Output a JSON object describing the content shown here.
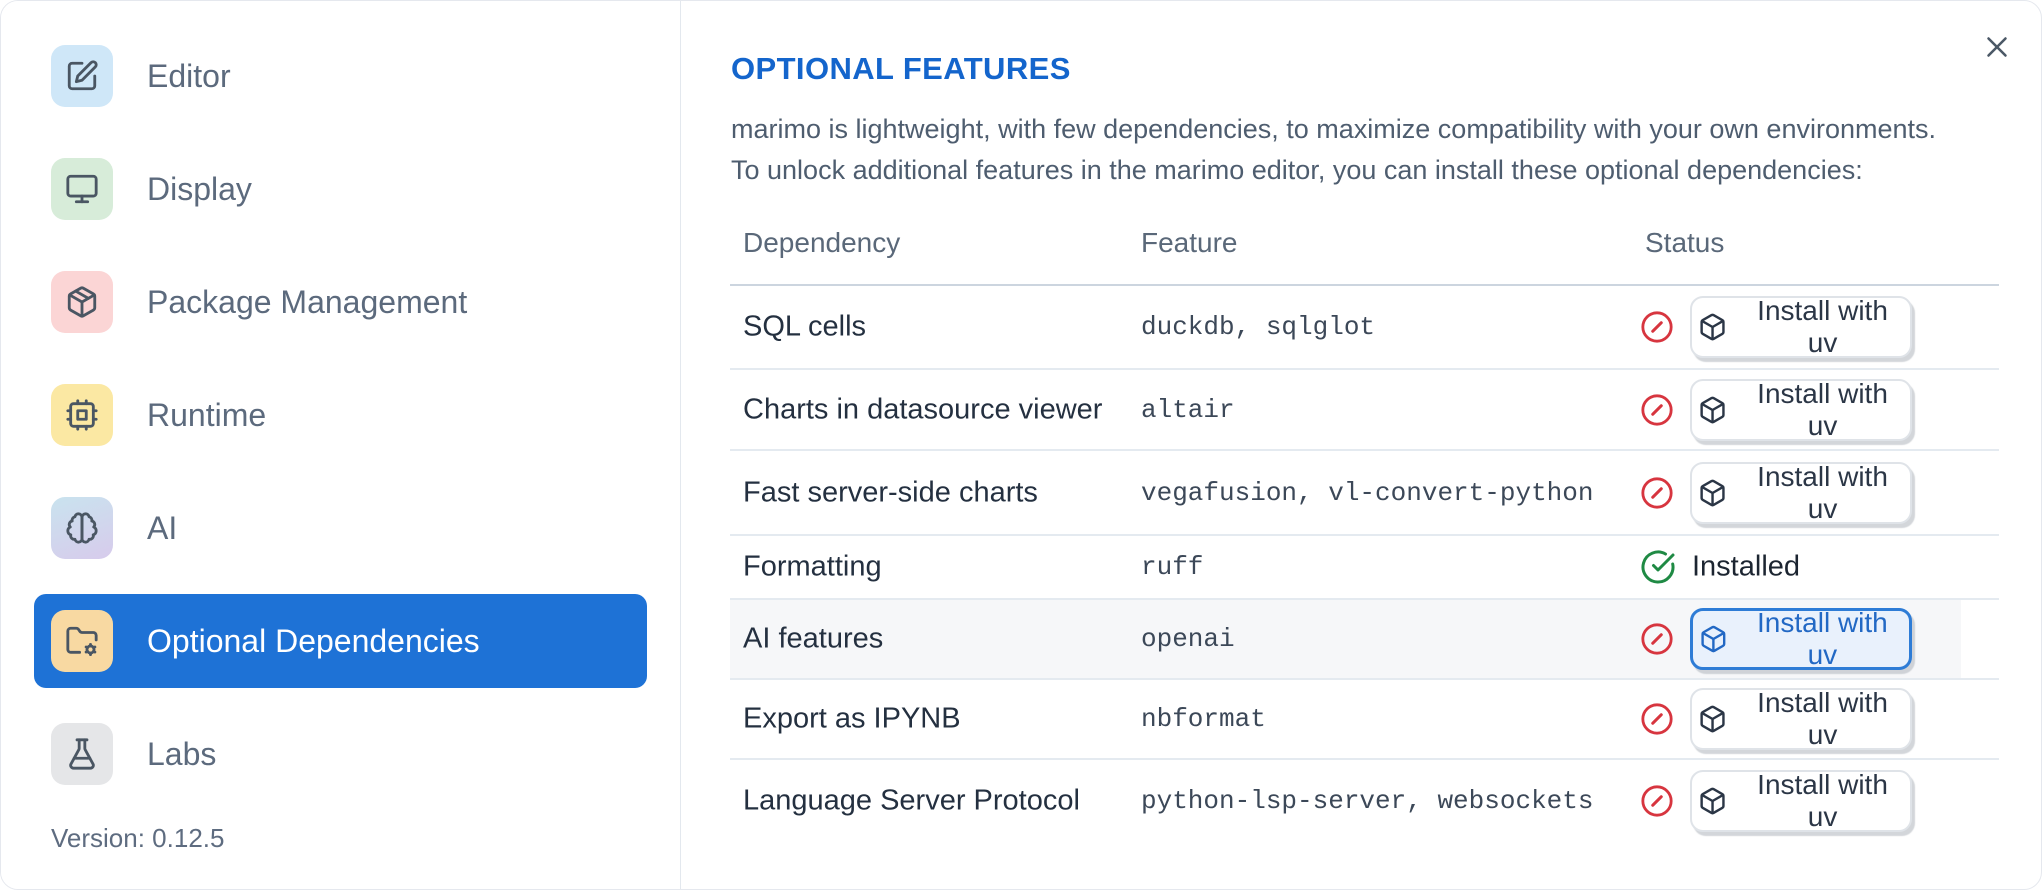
{
  "sidebar": {
    "items": [
      {
        "label": "Editor",
        "icon": "square-pen",
        "icon_bg": "#cfe7f8",
        "selected": false
      },
      {
        "label": "Display",
        "icon": "monitor",
        "icon_bg": "#d7ecd9",
        "selected": false
      },
      {
        "label": "Package Management",
        "icon": "package",
        "icon_bg": "#fbd5d5",
        "selected": false
      },
      {
        "label": "Runtime",
        "icon": "cpu",
        "icon_bg": "#fbe8a3",
        "selected": false
      },
      {
        "label": "AI",
        "icon": "brain",
        "icon_bg": "gradient",
        "selected": false
      },
      {
        "label": "Optional Dependencies",
        "icon": "folder-cog",
        "icon_bg": "#f8d9a2",
        "selected": true
      },
      {
        "label": "Labs",
        "icon": "flask",
        "icon_bg": "#e5e6e8",
        "selected": false
      }
    ],
    "version_label": "Version: 0.12.5"
  },
  "panel": {
    "title": "OPTIONAL FEATURES",
    "description_line1": "marimo is lightweight, with few dependencies, to maximize compatibility with your own environments.",
    "description_line2": "To unlock additional features in the marimo editor, you can install these optional dependencies:",
    "close_icon": "x-icon"
  },
  "table": {
    "headers": [
      "Dependency",
      "Feature",
      "Status"
    ],
    "install_button_label": "Install with uv",
    "install_button_icon": "box-icon",
    "installed_label": "Installed",
    "status_icons": {
      "not_installed": "circle-x-icon",
      "installed": "circle-check-icon"
    },
    "rows": [
      {
        "dependency": "SQL cells",
        "feature": "duckdb, sqlglot",
        "status": "not_installed",
        "highlighted": false,
        "button_focused": false
      },
      {
        "dependency": "Charts in datasource viewer",
        "feature": "altair",
        "status": "not_installed",
        "highlighted": false,
        "button_focused": false
      },
      {
        "dependency": "Fast server-side charts",
        "feature": "vegafusion, vl-convert-python",
        "status": "not_installed",
        "highlighted": false,
        "button_focused": false
      },
      {
        "dependency": "Formatting",
        "feature": "ruff",
        "status": "installed",
        "highlighted": false,
        "button_focused": false
      },
      {
        "dependency": "AI features",
        "feature": "openai",
        "status": "not_installed",
        "highlighted": true,
        "button_focused": true
      },
      {
        "dependency": "Export as IPYNB",
        "feature": "nbformat",
        "status": "not_installed",
        "highlighted": false,
        "button_focused": false
      },
      {
        "dependency": "Language Server Protocol",
        "feature": "python-lsp-server, websockets",
        "status": "not_installed",
        "highlighted": false,
        "button_focused": false
      }
    ]
  },
  "colors": {
    "selected_item_blue": "#1e72d6",
    "title_blue": "#1465cc",
    "focused_button_blue": "#2e7cd6",
    "status_red": "#d7353f",
    "status_green": "#1f8a44"
  }
}
